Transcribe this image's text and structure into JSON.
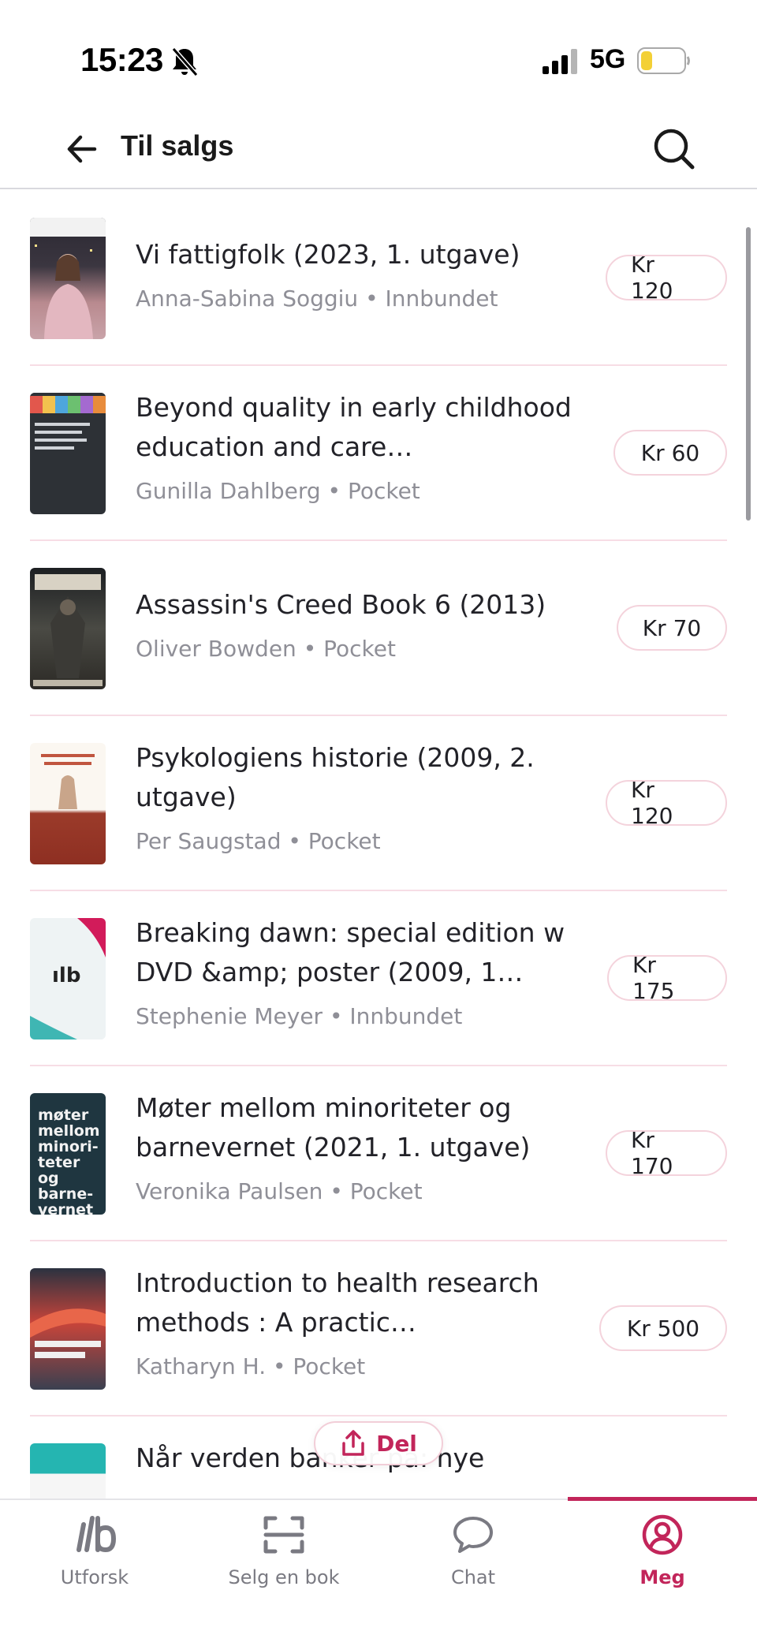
{
  "status_bar": {
    "time": "15:23",
    "network": "5G",
    "icons": [
      "bell-off-icon",
      "signal-icon",
      "battery-icon"
    ]
  },
  "header": {
    "title": "Til salgs",
    "back_icon": "arrow-left-icon",
    "search_icon": "search-icon"
  },
  "colors": {
    "accent": "#c2255a",
    "divider": "#f7dde5",
    "pill_border": "#f4d3dc",
    "meta_text": "#8f8f97"
  },
  "books": [
    {
      "title": "Vi fattigfolk (2023, 1. utgave)",
      "author": "Anna-Sabina Soggiu",
      "format": "Innbundet",
      "meta": "Anna-Sabina Soggiu • Innbundet",
      "price": "Kr 120"
    },
    {
      "title": "Beyond quality in early childhood education and care…",
      "author": "Gunilla Dahlberg",
      "format": "Pocket",
      "meta": "Gunilla Dahlberg • Pocket",
      "price": "Kr 60"
    },
    {
      "title": "Assassin's Creed Book 6 (2013)",
      "author": "Oliver Bowden",
      "format": "Pocket",
      "meta": "Oliver Bowden • Pocket",
      "price": "Kr 70"
    },
    {
      "title": "Psykologiens historie (2009, 2. utgave)",
      "author": "Per Saugstad",
      "format": "Pocket",
      "meta": "Per Saugstad • Pocket",
      "price": "Kr 120"
    },
    {
      "title": "Breaking dawn: special edition w DVD &amp; poster (2009, 1…",
      "author": "Stephenie Meyer",
      "format": "Innbundet",
      "meta": "Stephenie Meyer • Innbundet",
      "price": "Kr 175",
      "placeholder_cover_text": "ılb"
    },
    {
      "title": "Møter mellom minoriteter og barnevernet (2021, 1. utgave)",
      "author": "Veronika Paulsen",
      "format": "Pocket",
      "meta": "Veronika Paulsen • Pocket",
      "price": "Kr 170",
      "cover_text": "møter mellom minori- teter og barne- vernet"
    },
    {
      "title": "Introduction to health research methods : A practic…",
      "author": "Katharyn H.",
      "format": "Pocket",
      "meta": "Katharyn H. • Pocket",
      "price": "Kr 500"
    },
    {
      "title": "Når verden banker på: nye",
      "price": ""
    }
  ],
  "share_button": {
    "label": "Del",
    "icon": "share-icon"
  },
  "bottom_nav": [
    {
      "label": "Utforsk",
      "icon": "logo-icon",
      "active": false
    },
    {
      "label": "Selg en bok",
      "icon": "scan-icon",
      "active": false
    },
    {
      "label": "Chat",
      "icon": "chat-bubble-icon",
      "active": false
    },
    {
      "label": "Meg",
      "icon": "profile-icon",
      "active": true
    }
  ]
}
